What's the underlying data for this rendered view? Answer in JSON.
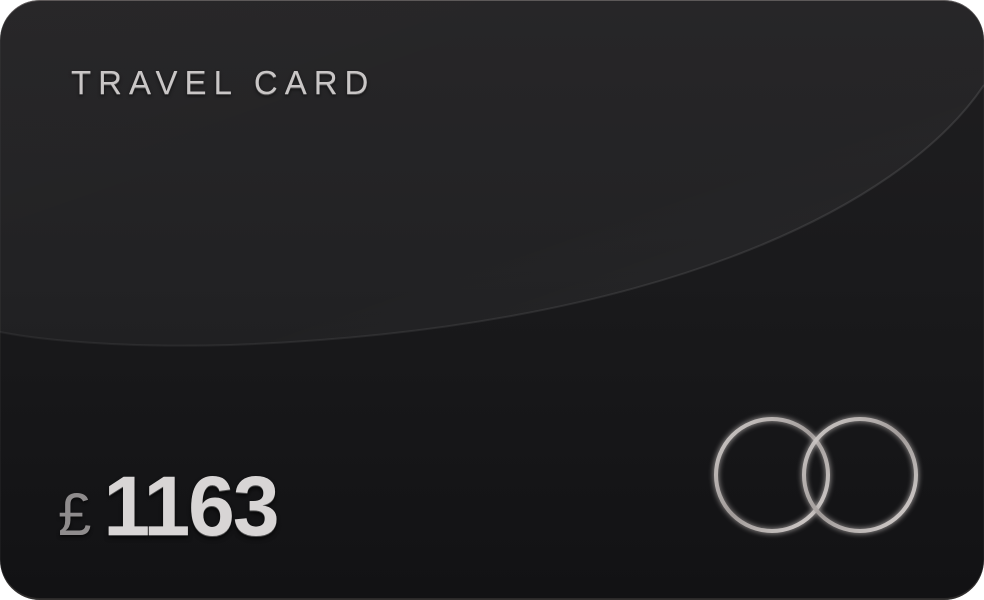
{
  "card": {
    "title": "TRAVEL CARD",
    "currency_symbol": "£",
    "balance": "1163"
  },
  "logo": {
    "icon": "interlocking-rings-icon"
  },
  "colors": {
    "card_background": "#1a1a1c",
    "text": "#d8d5d5",
    "ring": "#bdb8b6"
  }
}
